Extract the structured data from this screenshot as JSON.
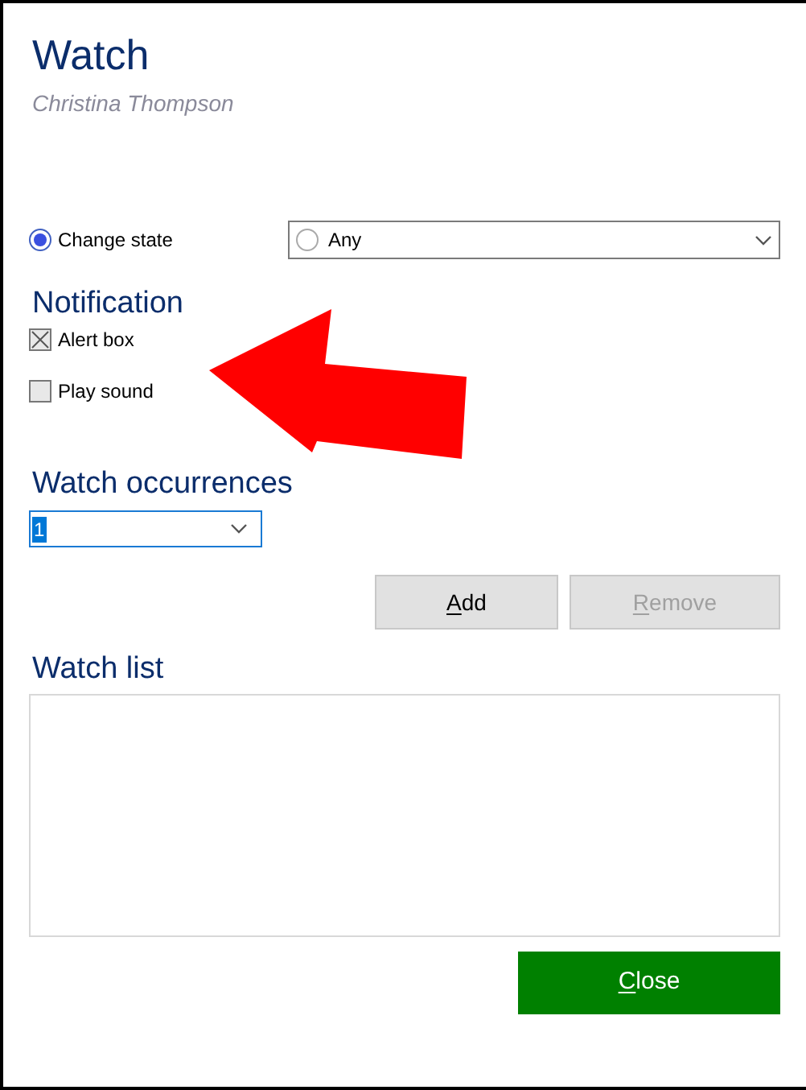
{
  "window": {
    "title": "Watch",
    "subtitle": "Christina Thompson"
  },
  "change_state": {
    "label": "Change state",
    "selected": true,
    "dropdown": {
      "value": "Any",
      "radio_selected": false
    }
  },
  "notification": {
    "heading": "Notification",
    "options": [
      {
        "label": "Alert box",
        "checked": true
      },
      {
        "label": "Play sound",
        "checked": false
      }
    ]
  },
  "occurrences": {
    "heading": "Watch occurrences",
    "value": "1"
  },
  "buttons": [
    {
      "label": "Add",
      "disabled": false
    },
    {
      "label": "Remove",
      "disabled": true
    }
  ],
  "watch_list": {
    "heading": "Watch list"
  },
  "close_button": {
    "label": "Close"
  }
}
